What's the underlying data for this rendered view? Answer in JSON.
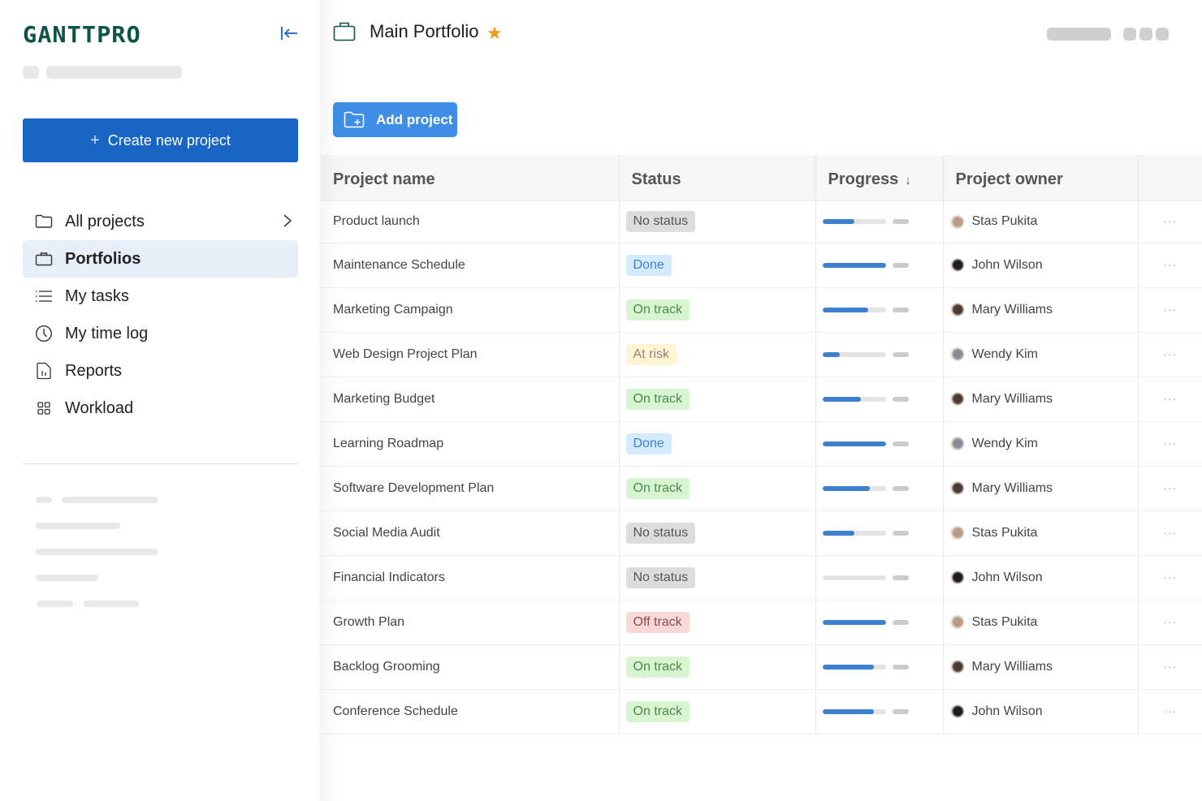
{
  "sidebar": {
    "logo": "GANTTPRO",
    "create_button": "Create new project",
    "nav": [
      {
        "label": "All projects",
        "icon": "folder-icon",
        "active": false,
        "has_chevron": true
      },
      {
        "label": "Portfolios",
        "icon": "briefcase-icon",
        "active": true
      },
      {
        "label": "My tasks",
        "icon": "list-icon",
        "active": false
      },
      {
        "label": "My time log",
        "icon": "clock-icon",
        "active": false
      },
      {
        "label": "Reports",
        "icon": "report-icon",
        "active": false
      },
      {
        "label": "Workload",
        "icon": "grid-icon",
        "active": false
      }
    ]
  },
  "header": {
    "title": "Main Portfolio",
    "favorite": true,
    "add_project_button": "Add project"
  },
  "table": {
    "columns": [
      "Project name",
      "Status",
      "Progress",
      "Project owner",
      ""
    ],
    "sort_column": "Progress",
    "sort_direction": "descending",
    "rows": [
      {
        "name": "Product launch",
        "status": "No status",
        "progress": 0.51,
        "owner": "Stas Pukita"
      },
      {
        "name": "Maintenance Schedule",
        "status": "Done",
        "progress": 1.0,
        "owner": "John Wilson"
      },
      {
        "name": "Marketing Campaign",
        "status": "On track",
        "progress": 0.73,
        "owner": "Mary Williams"
      },
      {
        "name": "Web Design Project Plan",
        "status": "At risk",
        "progress": 0.28,
        "owner": "Wendy Kim"
      },
      {
        "name": "Marketing Budget",
        "status": "On track",
        "progress": 0.61,
        "owner": "Mary Williams"
      },
      {
        "name": "Learning Roadmap",
        "status": "Done",
        "progress": 1.0,
        "owner": "Wendy Kim"
      },
      {
        "name": "Software Development Plan",
        "status": "On track",
        "progress": 0.75,
        "owner": "Mary Williams"
      },
      {
        "name": "Social Media Audit",
        "status": "No status",
        "progress": 0.5,
        "owner": "Stas Pukita"
      },
      {
        "name": "Financial Indicators",
        "status": "No status",
        "progress": 0.0,
        "owner": "John Wilson"
      },
      {
        "name": "Growth Plan",
        "status": "Off track",
        "progress": 1.0,
        "owner": "Stas Pukita"
      },
      {
        "name": "Backlog Grooming",
        "status": "On track",
        "progress": 0.81,
        "owner": "Mary Williams"
      },
      {
        "name": "Conference Schedule",
        "status": "On track",
        "progress": 0.81,
        "owner": "John Wilson"
      }
    ],
    "row_menu": "···"
  },
  "status_colors": {
    "No status": {
      "bg": "#dddddd",
      "fg": "#555555"
    },
    "Done": {
      "bg": "#d3ebfc",
      "fg": "#3d80cf"
    },
    "On track": {
      "bg": "#d8f5d2",
      "fg": "#4b8a46"
    },
    "At risk": {
      "bg": "#fdf5d3",
      "fg": "#a07c7c"
    },
    "Off track": {
      "bg": "#f8d9d8",
      "fg": "#8e4d4d"
    }
  },
  "owner_avatars": {
    "Stas Pukita": "#b99a84",
    "John Wilson": "#1c1c1c",
    "Mary Williams": "#4a3a35",
    "Wendy Kim": "#8a8a95"
  },
  "colors": {
    "brand": "#0d5347",
    "primary": "#1865c4",
    "add_button": "#3e8ee6",
    "progress_fill": "#3d80cf",
    "star": "#f59a17"
  }
}
